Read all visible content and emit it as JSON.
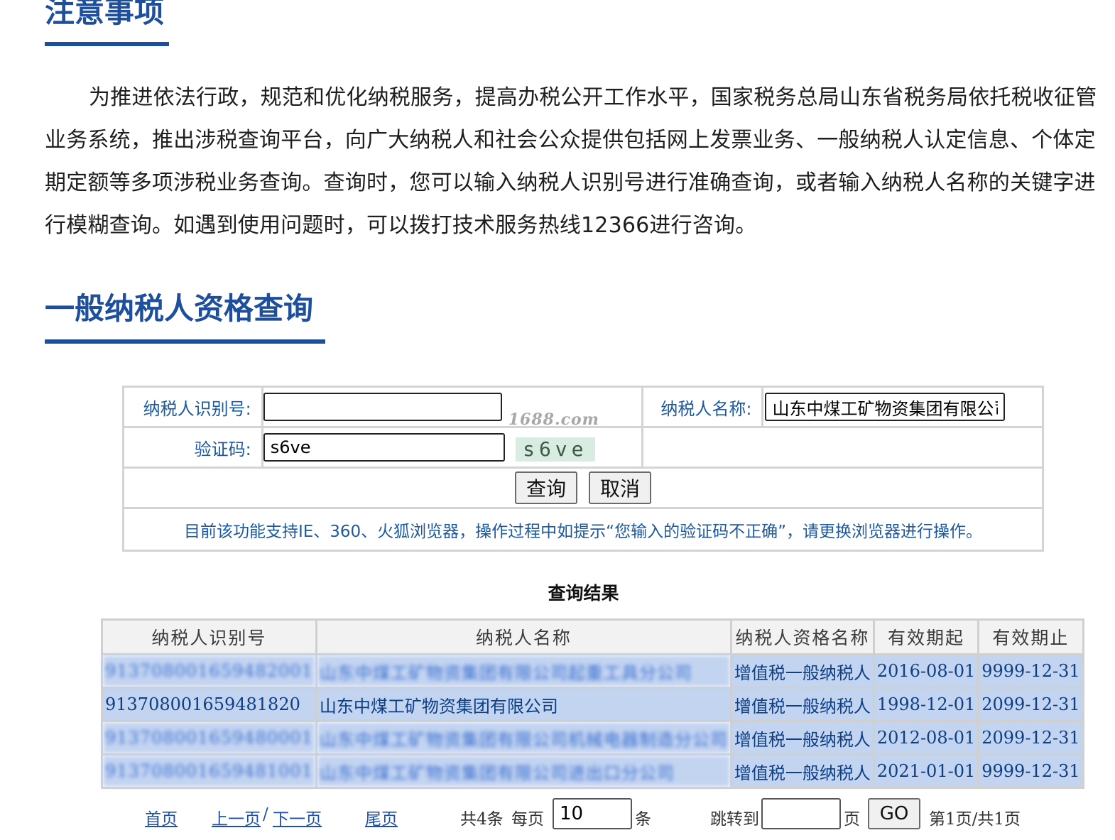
{
  "notice": {
    "title": "注意事项",
    "paragraph": "为推进依法行政，规范和优化纳税服务，提高办税公开工作水平，国家税务总局山东省税务局依托税收征管业务系统，推出涉税查询平台，向广大纳税人和社会公众提供包括网上发票业务、一般纳税人认定信息、个体定期定额等多项涉税业务查询。查询时，您可以输入纳税人识别号进行准确查询，或者输入纳税人名称的关键字进行模糊查询。如遇到使用问题时，可以拨打技术服务热线12366进行咨询。"
  },
  "query": {
    "title": "一般纳税人资格查询",
    "taxpayer_id_label": "纳税人识别号:",
    "taxpayer_id_value": "",
    "watermark": "1688.com",
    "taxpayer_name_label": "纳税人名称:",
    "taxpayer_name_value": "山东中煤工矿物资集团有限公司",
    "captcha_label": "验证码:",
    "captcha_value": "s6ve",
    "captcha_image_text": "s6ve",
    "search_button": "查询",
    "cancel_button": "取消",
    "support_note": "目前该功能支持IE、360、火狐浏览器，操作过程中如提示“您输入的验证码不正确”，请更换浏览器进行操作。"
  },
  "results": {
    "title": "查询结果",
    "headers": [
      "纳税人识别号",
      "纳税人名称",
      "纳税人资格名称",
      "有效期起",
      "有效期止"
    ],
    "rows": [
      [
        "913708001659482001",
        "山东中煤工矿物资集团有限公司起重工具分公司",
        "增值税一般纳税人",
        "2016-08-01",
        "9999-12-31"
      ],
      [
        "913708001659481820",
        "山东中煤工矿物资集团有限公司",
        "增值税一般纳税人",
        "1998-12-01",
        "2099-12-31"
      ],
      [
        "913708001659480001",
        "山东中煤工矿物资集团有限公司机械电器制造分公司",
        "增值税一般纳税人",
        "2012-08-01",
        "2099-12-31"
      ],
      [
        "913708001659481001",
        "山东中煤工矿物资集团有限公司进出口分公司",
        "增值税一般纳税人",
        "2021-01-01",
        "9999-12-31"
      ]
    ],
    "blurred_rows": [
      0,
      2,
      3
    ]
  },
  "pager": {
    "first": "首页",
    "prev": "上一页",
    "separator": "/",
    "next": "下一页",
    "last": "尾页",
    "total": "共4条",
    "per_page_label": "每页",
    "per_page_value": "10",
    "per_page_unit": "条",
    "jump_label": "跳转到",
    "jump_value": "",
    "page_unit": "页",
    "go_button": "GO",
    "status": "第1页/共1页"
  }
}
